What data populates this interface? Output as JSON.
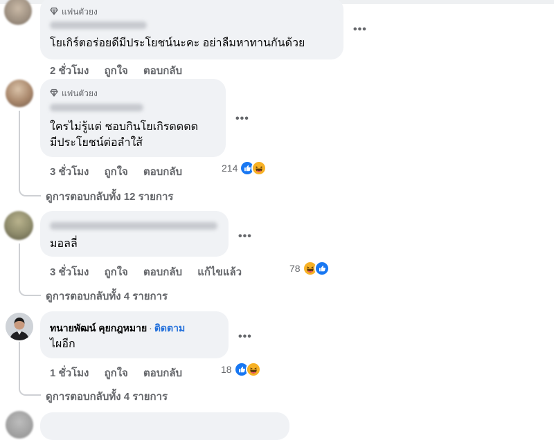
{
  "fan_badge": "แฟนตัวยง",
  "icons": {
    "fan": "diamond-icon",
    "more": "more-dots-icon",
    "like": "like-icon",
    "haha": "haha-icon"
  },
  "colors": {
    "like_blue": "#1877f2",
    "haha_yellow": "#f7b125",
    "follow_blue": "#216fdb",
    "bubble": "#f0f2f5"
  },
  "comments": [
    {
      "text_lines": [
        "โยเกิร์ตอร่อยดีมีประโยชน์นะคะ อย่าลืมหาทานกันด้วย"
      ],
      "time": "2 ชั่วโมง",
      "like": "ถูกใจ",
      "reply": "ตอบกลับ"
    },
    {
      "text_lines": [
        "ใครไม่รู้แต่ ชอบกินโยเกิรดดดด",
        "มีประโยชน์ต่อลำใส้"
      ],
      "time": "3 ชั่วโมง",
      "like": "ถูกใจ",
      "reply": "ตอบกลับ",
      "reaction_count": "214",
      "view_replies": "ดูการตอบกลับทั้ง 12 รายการ"
    },
    {
      "text_lines": [
        "มอลลี่"
      ],
      "time": "3 ชั่วโมง",
      "like": "ถูกใจ",
      "reply": "ตอบกลับ",
      "edited": "แก้ไขแล้ว",
      "reaction_count": "78",
      "view_replies": "ดูการตอบกลับทั้ง 4 รายการ"
    },
    {
      "author": "ทนายพัฒน์ คุยกฎหมาย",
      "separator": "·",
      "follow": "ติดตาม",
      "text_lines": [
        "ไผอีก"
      ],
      "time": "1 ชั่วโมง",
      "like": "ถูกใจ",
      "reply": "ตอบกลับ",
      "reaction_count": "18",
      "view_replies": "ดูการตอบกลับทั้ง 4 รายการ"
    }
  ]
}
